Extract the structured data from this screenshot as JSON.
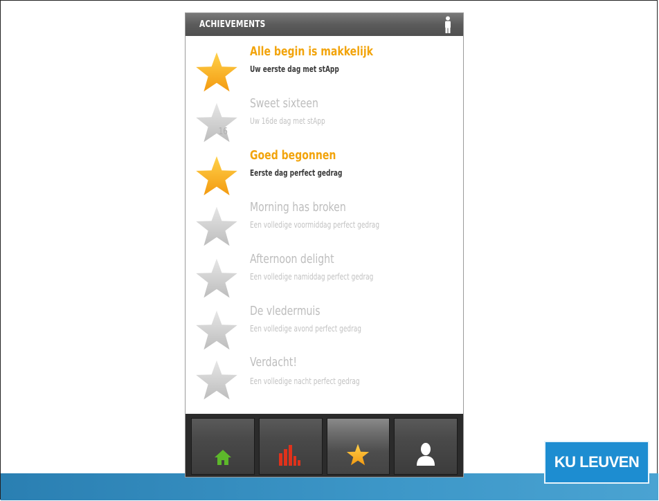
{
  "header": {
    "title": "ACHIEVEMENTS",
    "profile_icon": "person-icon"
  },
  "achievements": [
    {
      "title": "Alle begin is makkelijk",
      "desc": "Uw eerste dag met stApp",
      "unlocked": true
    },
    {
      "title": "Sweet sixteen",
      "desc": "Uw 16de dag met stApp",
      "unlocked": false,
      "badge": "16"
    },
    {
      "title": "Goed begonnen",
      "desc": "Eerste dag perfect gedrag",
      "unlocked": true
    },
    {
      "title": "Morning has broken",
      "desc": "Een volledige voormiddag perfect gedrag",
      "unlocked": false
    },
    {
      "title": "Afternoon delight",
      "desc": "Een volledige namiddag perfect gedrag",
      "unlocked": false
    },
    {
      "title": "De vledermuis",
      "desc": "Een volledige avond perfect gedrag",
      "unlocked": false
    },
    {
      "title": "Verdacht!",
      "desc": "Een volledige nacht perfect gedrag",
      "unlocked": false
    }
  ],
  "tabs": [
    {
      "name": "home",
      "icon": "home-icon",
      "color": "#5db82b"
    },
    {
      "name": "stats",
      "icon": "bar-chart-icon",
      "color": "#e0321b"
    },
    {
      "name": "achievements",
      "icon": "star-icon",
      "color": "#f7a81a",
      "active": true
    },
    {
      "name": "profile",
      "icon": "user-icon",
      "color": "#ffffff"
    }
  ],
  "logo": {
    "text": "KU LEUVEN"
  },
  "colors": {
    "accent": "#f2a40c",
    "locked": "#bdbdbd",
    "band": "#3d97c8",
    "logo": "#1d8dd1"
  }
}
